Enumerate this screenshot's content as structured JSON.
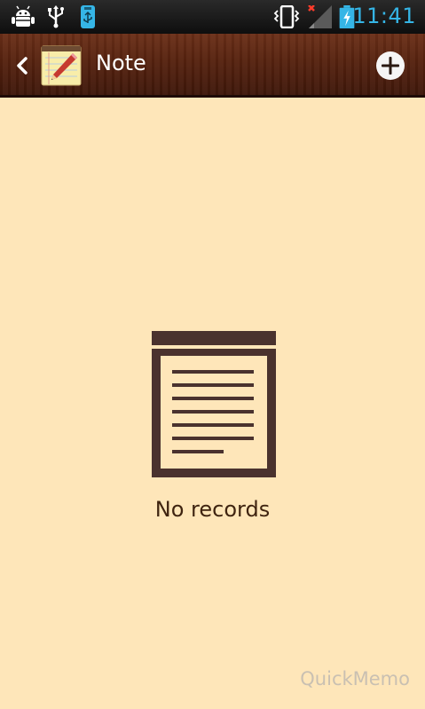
{
  "status_bar": {
    "icons": [
      "android-debug-icon",
      "usb-icon",
      "usb-storage-icon",
      "vibrate-icon",
      "signal-icon",
      "battery-charging-icon"
    ],
    "time": "11:41",
    "accent_color": "#35b5e6"
  },
  "action_bar": {
    "back_icon": "chevron-left-icon",
    "app_icon": "notepad-pencil-icon",
    "title": "Note",
    "add_icon": "plus-circle-icon"
  },
  "main": {
    "empty_icon": "note-document-icon",
    "empty_message": "No records"
  },
  "footer": {
    "brand": "QuickMemo"
  },
  "colors": {
    "background": "#fee6b9",
    "action_bar": "#56220f",
    "empty_icon": "#4a322e",
    "text": "#3f2410"
  }
}
